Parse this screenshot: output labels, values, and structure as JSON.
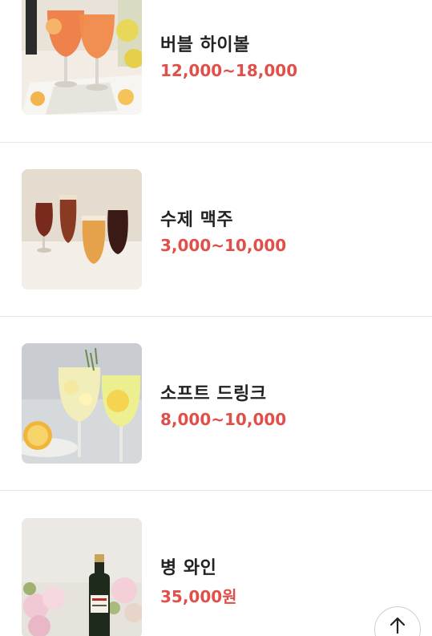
{
  "menu": {
    "items": [
      {
        "name": "버블 하이볼",
        "price": "12,000~18,000",
        "image": "highball-drinks-photo"
      },
      {
        "name": "수제 맥주",
        "price": "3,000~10,000",
        "image": "craft-beer-glasses-photo"
      },
      {
        "name": "소프트 드링크",
        "price": "8,000~10,000",
        "image": "lemon-soft-drink-photo"
      },
      {
        "name": "병 와인",
        "price": "35,000원",
        "image": "bottle-wine-flowers-photo"
      }
    ]
  },
  "controls": {
    "scroll_top_icon": "arrow-up-icon"
  },
  "colors": {
    "price": "#e0504a",
    "name": "#222222",
    "divider": "#e6e6e6"
  }
}
